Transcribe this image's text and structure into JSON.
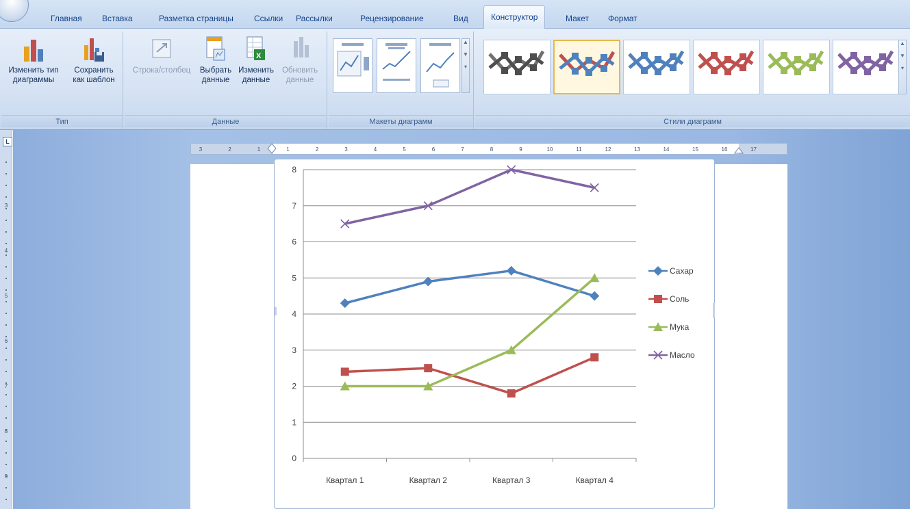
{
  "tabs": [
    {
      "label": "Главная"
    },
    {
      "label": "Вставка"
    },
    {
      "label": "Разметка страницы"
    },
    {
      "label": "Ссылки"
    },
    {
      "label": "Рассылки"
    },
    {
      "label": "Рецензирование"
    },
    {
      "label": "Вид"
    },
    {
      "label": "Конструктор"
    },
    {
      "label": "Макет"
    },
    {
      "label": "Формат"
    }
  ],
  "ribbon": {
    "type_group": {
      "label": "Тип",
      "change_type": {
        "line1": "Изменить тип",
        "line2": "диаграммы"
      },
      "save_template": {
        "line1": "Сохранить",
        "line2": "как шаблон"
      }
    },
    "data_group": {
      "label": "Данные",
      "switch_row_col": {
        "line1": "Строка/столбец"
      },
      "select_data": {
        "line1": "Выбрать",
        "line2": "данные"
      },
      "edit_data": {
        "line1": "Изменить",
        "line2": "данные"
      },
      "refresh_data": {
        "line1": "Обновить",
        "line2": "данные"
      }
    },
    "layouts_group": {
      "label": "Макеты диаграмм"
    },
    "styles_group": {
      "label": "Стили диаграмм"
    },
    "style_colors": [
      "#707070",
      "#c0504d",
      "#4f81bd",
      "#c0504d",
      "#9bbb59",
      "#8064a2"
    ],
    "style_node_colors": [
      "#4d4d4d",
      "#4f81bd",
      "#4f81bd",
      "#c0504d",
      "#9bbb59",
      "#8064a2"
    ]
  },
  "ruler": {
    "vertical_corner": "L",
    "h_labels": [
      "3",
      "2",
      "1",
      "1",
      "2",
      "3",
      "4",
      "5",
      "6",
      "7",
      "8",
      "9",
      "10",
      "11",
      "12",
      "13",
      "14",
      "15",
      "16",
      "17"
    ],
    "v_labels": [
      "3",
      "4",
      "5",
      "6",
      "7",
      "8",
      "9"
    ]
  },
  "chart_data": {
    "type": "line",
    "categories": [
      "Квартал 1",
      "Квартал 2",
      "Квартал 3",
      "Квартал 4"
    ],
    "series": [
      {
        "name": "Сахар",
        "values": [
          4.3,
          4.9,
          5.2,
          4.5
        ],
        "color": "#4f81bd",
        "marker": "diamond"
      },
      {
        "name": "Соль",
        "values": [
          2.4,
          2.5,
          1.8,
          2.8
        ],
        "color": "#c0504d",
        "marker": "square"
      },
      {
        "name": "Мука",
        "values": [
          2.0,
          2.0,
          3.0,
          5.0
        ],
        "color": "#9bbb59",
        "marker": "triangle"
      },
      {
        "name": "Масло",
        "values": [
          6.5,
          7.0,
          8.0,
          7.5
        ],
        "color": "#8064a2",
        "marker": "x"
      }
    ],
    "y_ticks": [
      "0",
      "1",
      "2",
      "3",
      "4",
      "5",
      "6",
      "7",
      "8"
    ],
    "ylim": [
      0,
      8
    ],
    "grid": true,
    "legend_position": "right"
  }
}
